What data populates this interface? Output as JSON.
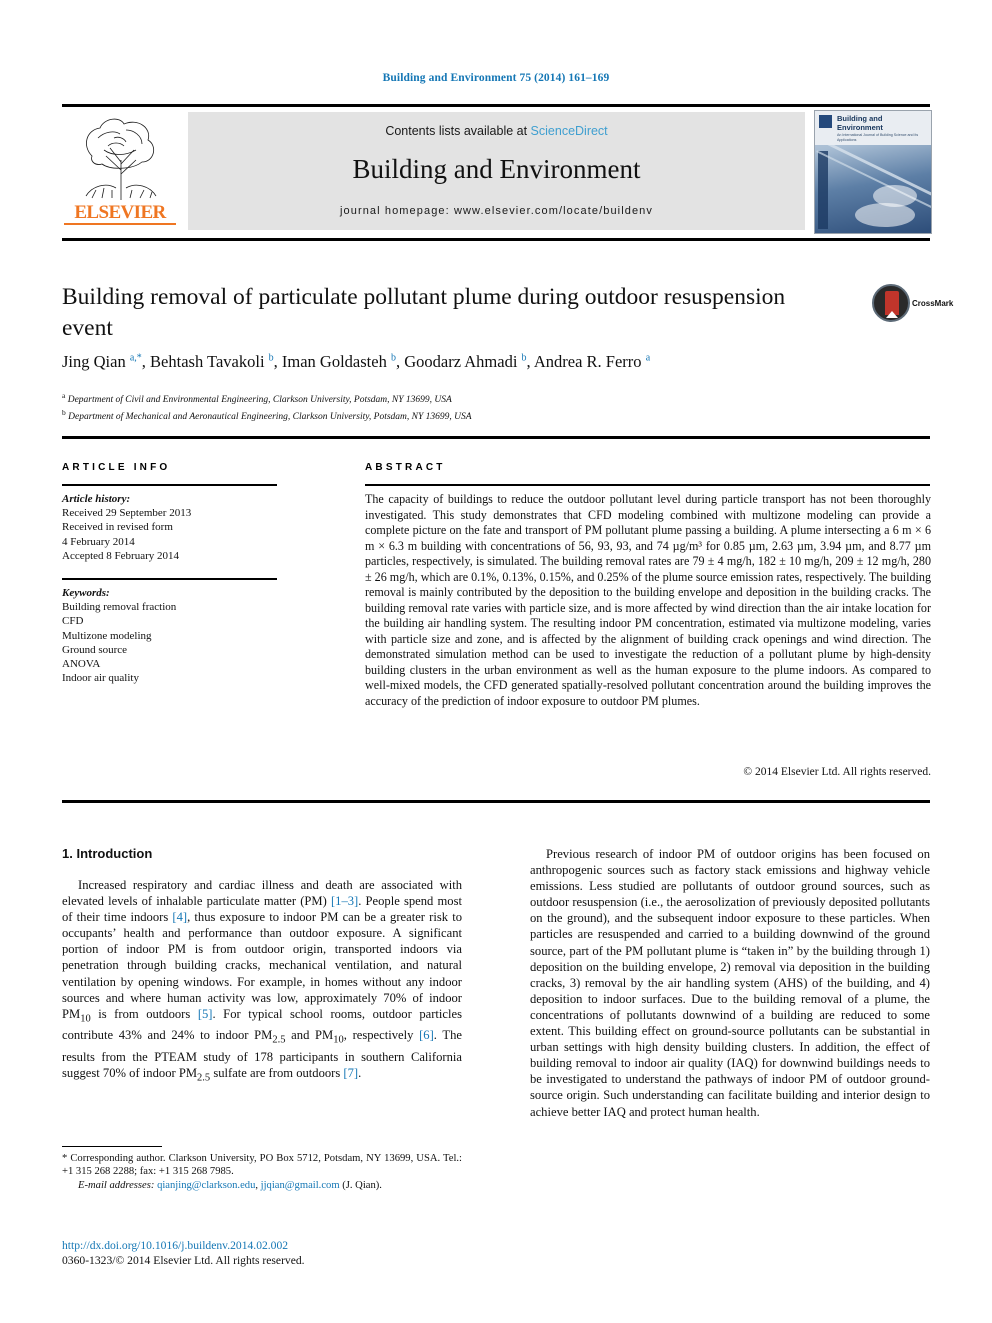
{
  "running_head": "Building and Environment 75 (2014) 161–169",
  "masthead": {
    "publisher_name": "ELSEVIER",
    "contents_prefix": "Contents lists available at ",
    "contents_link": "ScienceDirect",
    "journal_title": "Building and Environment",
    "homepage": "journal homepage: www.elsevier.com/locate/buildenv",
    "cover_title": "Building and Environment",
    "cover_subtitle": "An International Journal of Building Science and its Applications"
  },
  "article": {
    "title": "Building removal of particulate pollutant plume during outdoor resuspension event",
    "crossmark_label": "CrossMark",
    "authors_html": "Jing Qian <sup>a,*</sup>, Behtash Tavakoli <sup>b</sup>, Iman Goldasteh <sup>b</sup>, Goodarz Ahmadi <sup>b</sup>, Andrea R. Ferro <sup>a</sup>",
    "affiliations": [
      "Department of Civil and Environmental Engineering, Clarkson University, Potsdam, NY 13699, USA",
      "Department of Mechanical and Aeronautical Engineering, Clarkson University, Potsdam, NY 13699, USA"
    ]
  },
  "sections": {
    "article_info_heading": "ARTICLE INFO",
    "abstract_heading": "ABSTRACT"
  },
  "article_info": {
    "history_label": "Article history:",
    "history_lines": [
      "Received 29 September 2013",
      "Received in revised form",
      "4 February 2014",
      "Accepted 8 February 2014"
    ],
    "keywords_label": "Keywords:",
    "keywords": [
      "Building removal fraction",
      "CFD",
      "Multizone modeling",
      "Ground source",
      "ANOVA",
      "Indoor air quality"
    ]
  },
  "abstract": {
    "text": "The capacity of buildings to reduce the outdoor pollutant level during particle transport has not been thoroughly investigated. This study demonstrates that CFD modeling combined with multizone modeling can provide a complete picture on the fate and transport of PM pollutant plume passing a building. A plume intersecting a 6 m × 6 m × 6.3 m building with concentrations of 56, 93, 93, and 74 µg/m³ for 0.85 µm, 2.63 µm, 3.94 µm, and 8.77 µm particles, respectively, is simulated. The building removal rates are 79 ± 4 mg/h, 182 ± 10 mg/h, 209 ± 12 mg/h, 280 ± 26 mg/h, which are 0.1%, 0.13%, 0.15%, and 0.25% of the plume source emission rates, respectively. The building removal is mainly contributed by the deposition to the building envelope and deposition in the building cracks. The building removal rate varies with particle size, and is more affected by wind direction than the air intake location for the building air handling system. The resulting indoor PM concentration, estimated via multizone modeling, varies with particle size and zone, and is affected by the alignment of building crack openings and wind direction. The demonstrated simulation method can be used to investigate the reduction of a pollutant plume by high-density building clusters in the urban environment as well as the human exposure to the plume indoors. As compared to well-mixed models, the CFD generated spatially-resolved pollutant concentration around the building improves the accuracy of the prediction of indoor exposure to outdoor PM plumes.",
    "copyright": "© 2014 Elsevier Ltd. All rights reserved."
  },
  "body": {
    "intro_heading": "1. Introduction",
    "left_paragraph_html": "Increased respiratory and cardiac illness and death are associated with elevated levels of inhalable particulate matter (PM) <span class=\"ref\">[1–3]</span>. People spend most of their time indoors <span class=\"ref\">[4]</span>, thus exposure to indoor PM can be a greater risk to occupants’ health and performance than outdoor exposure. A significant portion of indoor PM is from outdoor origin, transported indoors via penetration through building cracks, mechanical ventilation, and natural ventilation by opening windows. For example, in homes without any indoor sources and where human activity was low, approximately 70% of indoor PM<sub>10</sub> is from outdoors <span class=\"ref\">[5]</span>. For typical school rooms, outdoor particles contribute 43% and 24% to indoor PM<sub>2.5</sub> and PM<sub>10</sub>, respectively <span class=\"ref\">[6]</span>. The results from the PTEAM study of 178 participants in southern California suggest 70% of indoor PM<sub>2.5</sub> sulfate are from outdoors <span class=\"ref\">[7]</span>.",
    "right_paragraph_html": "Previous research of indoor PM of outdoor origins has been focused on anthropogenic sources such as factory stack emissions and highway vehicle emissions. Less studied are pollutants of outdoor ground sources, such as outdoor resuspension (i.e., the aerosolization of previously deposited pollutants on the ground), and the subsequent indoor exposure to these particles. When particles are resuspended and carried to a building downwind of the ground source, part of the PM pollutant plume is “taken in” by the building through 1) deposition on the building envelope, 2) removal via deposition in the building cracks, 3) removal by the air handling system (AHS) of the building, and 4) deposition to indoor surfaces. Due to the building removal of a plume, the concentrations of pollutants downwind of a building are reduced to some extent. This building effect on ground-source pollutants can be substantial in urban settings with high density building clusters. In addition, the effect of building removal to indoor air quality (IAQ) for downwind buildings needs to be investigated to understand the pathways of indoor PM of outdoor ground-source origin. Such understanding can facilitate building and interior design to achieve better IAQ and protect human health."
  },
  "footnote": {
    "corresponding_html": "* Corresponding author. Clarkson University, PO Box 5712, Potsdam, NY 13699, USA. Tel.: +1 315 268 2288; fax: +1 315 268 7985.",
    "email_label": "E-mail addresses:",
    "email_1": "qianjing@clarkson.edu",
    "email_2": "jjqian@gmail.com",
    "email_suffix": "(J. Qian)."
  },
  "doi": {
    "link": "http://dx.doi.org/10.1016/j.buildenv.2014.02.002",
    "issn_line": "0360-1323/© 2014 Elsevier Ltd. All rights reserved."
  },
  "colors": {
    "link_blue": "#1577b5",
    "sciencedirect_blue": "#3f9fd0",
    "elsevier_orange": "#ef7622"
  }
}
